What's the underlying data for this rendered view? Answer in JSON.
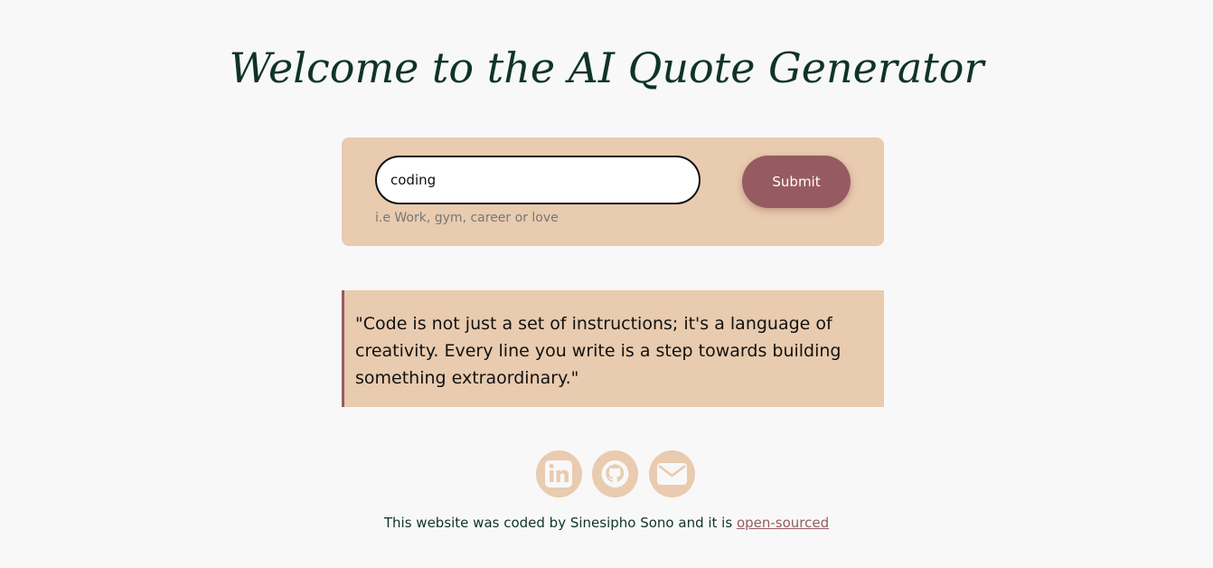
{
  "header": {
    "title": "Welcome to the AI Quote Generator"
  },
  "form": {
    "input_value": "coding",
    "hint": "i.e Work, gym, career or love",
    "submit_label": "Submit"
  },
  "quote": {
    "text": "\"Code is not just a set of instructions; it's a language of creativity. Every line you write is a step towards building something extraordinary.\""
  },
  "socials": [
    {
      "icon": "linkedin-icon"
    },
    {
      "icon": "github-icon"
    },
    {
      "icon": "envelope-icon"
    }
  ],
  "footer": {
    "text": "This website was coded by Sinesipho Sono and it is ",
    "link_label": "open-sourced"
  },
  "colors": {
    "background": "#f8f8f8",
    "panel": "#e9cbaf",
    "accent": "#965b61",
    "title": "#0f3328"
  }
}
